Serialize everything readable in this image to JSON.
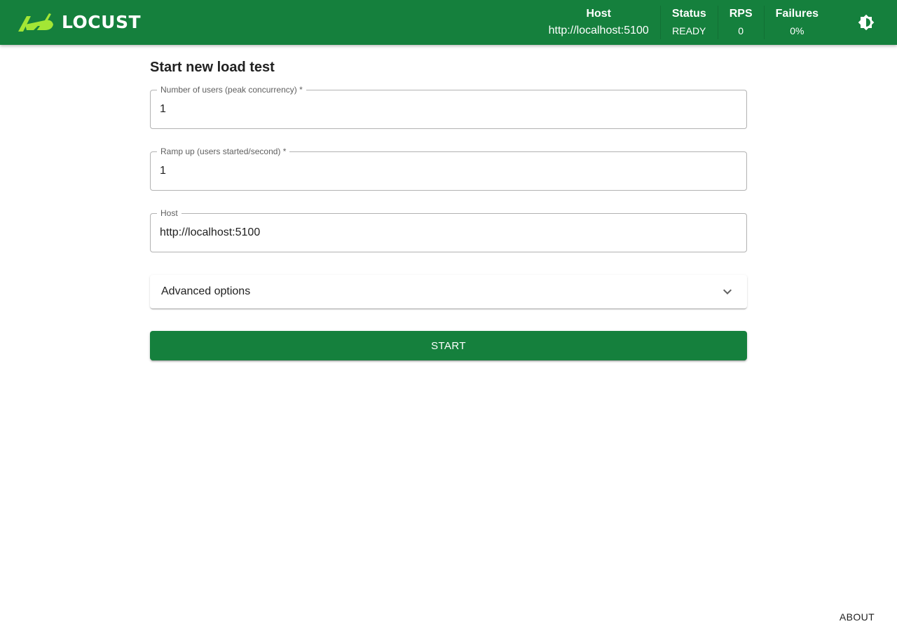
{
  "colors": {
    "brand": "#15803d",
    "logo_mark": "#a3e635",
    "text": "#212121"
  },
  "header": {
    "logo": {
      "text": "LOCUST",
      "icon": "locust-logo-icon"
    },
    "stats": [
      {
        "label": "Host",
        "value": "http://localhost:5100"
      },
      {
        "label": "Status",
        "value": "READY"
      },
      {
        "label": "RPS",
        "value": "0"
      },
      {
        "label": "Failures",
        "value": "0%"
      }
    ],
    "theme_toggle_icon": "brightness-icon"
  },
  "form": {
    "title": "Start new load test",
    "fields": [
      {
        "label": "Number of users (peak concurrency) *",
        "value": "1"
      },
      {
        "label": "Ramp up (users started/second) *",
        "value": "1"
      },
      {
        "label": "Host",
        "value": "http://localhost:5100"
      }
    ],
    "advanced": {
      "label": "Advanced options",
      "icon": "chevron-down-icon"
    },
    "start_label": "START"
  },
  "footer": {
    "about_label": "ABOUT"
  }
}
